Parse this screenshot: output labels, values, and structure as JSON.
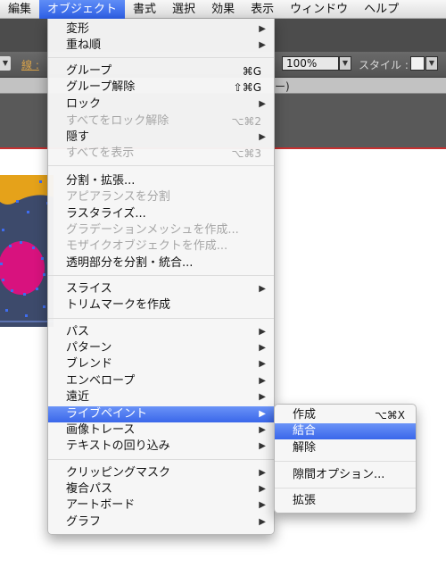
{
  "menubar": {
    "items": [
      {
        "label": "編集",
        "active": false
      },
      {
        "label": "オブジェクト",
        "active": true
      },
      {
        "label": "書式",
        "active": false
      },
      {
        "label": "選択",
        "active": false
      },
      {
        "label": "効果",
        "active": false
      },
      {
        "label": "表示",
        "active": false
      },
      {
        "label": "ウィンドウ",
        "active": false
      },
      {
        "label": "ヘルプ",
        "active": false
      }
    ]
  },
  "controlbar": {
    "stroke_label": "線 :",
    "zoom_value": "100%",
    "style_label": "スタイル :"
  },
  "doc_tab": {
    "text": "ー)"
  },
  "object_menu": {
    "items": [
      {
        "label": "変形",
        "shortcut": "",
        "submenu": true,
        "disabled": false
      },
      {
        "label": "重ね順",
        "shortcut": "",
        "submenu": true,
        "disabled": false
      },
      {
        "label": "グループ",
        "shortcut": "⌘G",
        "submenu": false,
        "disabled": false
      },
      {
        "label": "グループ解除",
        "shortcut": "⇧⌘G",
        "submenu": false,
        "disabled": false
      },
      {
        "label": "ロック",
        "shortcut": "",
        "submenu": true,
        "disabled": false
      },
      {
        "label": "すべてをロック解除",
        "shortcut": "⌥⌘2",
        "submenu": false,
        "disabled": true
      },
      {
        "label": "隠す",
        "shortcut": "",
        "submenu": true,
        "disabled": false
      },
      {
        "label": "すべてを表示",
        "shortcut": "⌥⌘3",
        "submenu": false,
        "disabled": true
      },
      {
        "label": "分割・拡張...",
        "shortcut": "",
        "submenu": false,
        "disabled": false
      },
      {
        "label": "アピアランスを分割",
        "shortcut": "",
        "submenu": false,
        "disabled": true
      },
      {
        "label": "ラスタライズ...",
        "shortcut": "",
        "submenu": false,
        "disabled": false
      },
      {
        "label": "グラデーションメッシュを作成...",
        "shortcut": "",
        "submenu": false,
        "disabled": true
      },
      {
        "label": "モザイクオブジェクトを作成...",
        "shortcut": "",
        "submenu": false,
        "disabled": true
      },
      {
        "label": "透明部分を分割・統合...",
        "shortcut": "",
        "submenu": false,
        "disabled": false
      },
      {
        "label": "スライス",
        "shortcut": "",
        "submenu": true,
        "disabled": false
      },
      {
        "label": "トリムマークを作成",
        "shortcut": "",
        "submenu": false,
        "disabled": false
      },
      {
        "label": "パス",
        "shortcut": "",
        "submenu": true,
        "disabled": false
      },
      {
        "label": "パターン",
        "shortcut": "",
        "submenu": true,
        "disabled": false
      },
      {
        "label": "ブレンド",
        "shortcut": "",
        "submenu": true,
        "disabled": false
      },
      {
        "label": "エンベロープ",
        "shortcut": "",
        "submenu": true,
        "disabled": false
      },
      {
        "label": "遠近",
        "shortcut": "",
        "submenu": true,
        "disabled": false
      },
      {
        "label": "ライブペイント",
        "shortcut": "",
        "submenu": true,
        "disabled": false,
        "highlighted": true
      },
      {
        "label": "画像トレース",
        "shortcut": "",
        "submenu": true,
        "disabled": false
      },
      {
        "label": "テキストの回り込み",
        "shortcut": "",
        "submenu": true,
        "disabled": false
      },
      {
        "label": "クリッピングマスク",
        "shortcut": "",
        "submenu": true,
        "disabled": false
      },
      {
        "label": "複合パス",
        "shortcut": "",
        "submenu": true,
        "disabled": false
      },
      {
        "label": "アートボード",
        "shortcut": "",
        "submenu": true,
        "disabled": false
      },
      {
        "label": "グラフ",
        "shortcut": "",
        "submenu": true,
        "disabled": false
      }
    ]
  },
  "livepaint_submenu": {
    "items": [
      {
        "label": "作成",
        "shortcut": "⌥⌘X",
        "highlighted": false
      },
      {
        "label": "結合",
        "shortcut": "",
        "highlighted": true
      },
      {
        "label": "解除",
        "shortcut": "",
        "highlighted": false
      },
      {
        "label": "隙間オプション...",
        "shortcut": "",
        "highlighted": false
      },
      {
        "label": "拡張",
        "shortcut": "",
        "highlighted": false
      }
    ]
  },
  "colors": {
    "menu_highlight": "#3a67ea",
    "artwork_orange": "#e5a21a",
    "artwork_navy": "#3d4a6b",
    "artwork_magenta": "#d8127e",
    "selection_blue": "#3f6df0"
  },
  "icons": {
    "submenu_arrow": "triangle-right-icon",
    "dropdown_arrow": "triangle-down-icon"
  }
}
